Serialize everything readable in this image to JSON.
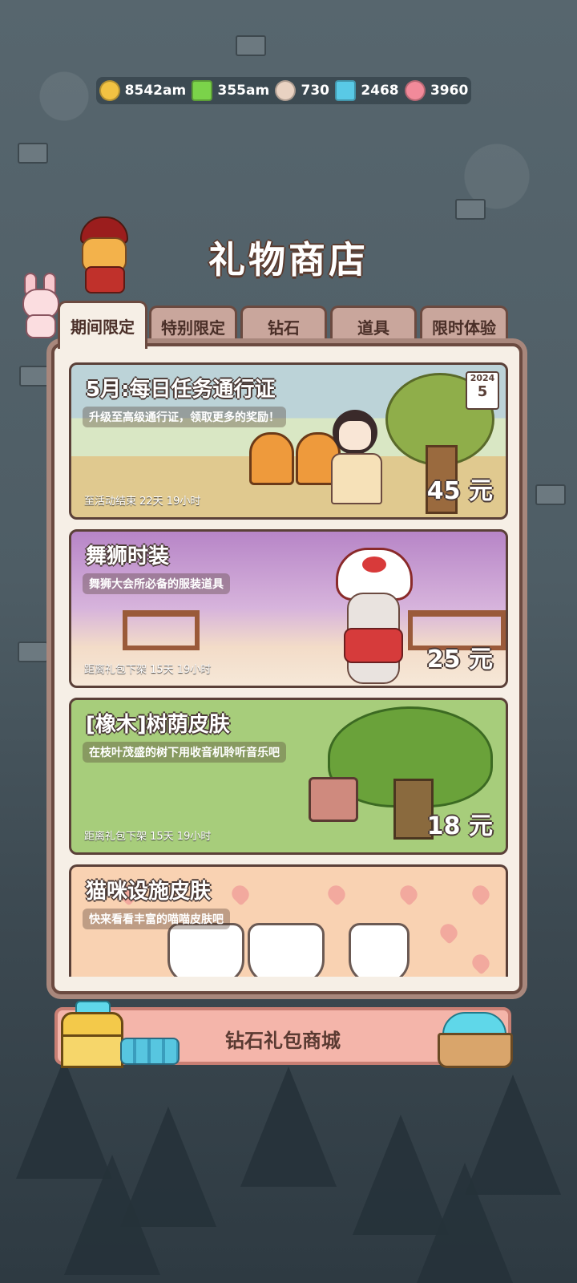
{
  "resources": [
    {
      "name": "gold",
      "value": "8542am",
      "color": "#f1c243",
      "icon": "coin-icon"
    },
    {
      "name": "energy",
      "value": "355am",
      "color": "#7bd34a",
      "icon": "lightning-icon"
    },
    {
      "name": "fish",
      "value": "730",
      "color": "#e9d2c2",
      "icon": "fish-icon"
    },
    {
      "name": "diamond",
      "value": "2468",
      "color": "#59c9e6",
      "icon": "diamond-icon"
    },
    {
      "name": "candy",
      "value": "3960",
      "color": "#f28a9a",
      "icon": "candy-icon"
    }
  ],
  "title": "礼物商店",
  "tabs": [
    "期间限定",
    "特别限定",
    "钻石",
    "道具",
    "限时体验"
  ],
  "cards": [
    {
      "title": "5月:每日任务通行证",
      "subtitle": "升级至高级通行证，领取更多的奖励！",
      "timer": "至活动结束 22天 19小时",
      "price": "45 元",
      "calendar_year": "2024",
      "calendar_day": "5"
    },
    {
      "title": "舞狮时装",
      "subtitle": "舞狮大会所必备的服装道具",
      "timer": "距离礼包下架 15天 19小时",
      "price": "25 元"
    },
    {
      "title": "[橡木]树荫皮肤",
      "subtitle": "在枝叶茂盛的树下用收音机聆听音乐吧",
      "timer": "距离礼包下架 15天 19小时",
      "price": "18 元"
    },
    {
      "title": "猫咪设施皮肤",
      "subtitle": "快来看看丰富的喵喵皮肤吧"
    }
  ],
  "banner_label": "钻石礼包商城",
  "colors": {
    "panel_border": "#6b4a40",
    "panel_bg": "#f6efe6",
    "tab": "#c9a69c",
    "banner": "#f4b5aa"
  }
}
